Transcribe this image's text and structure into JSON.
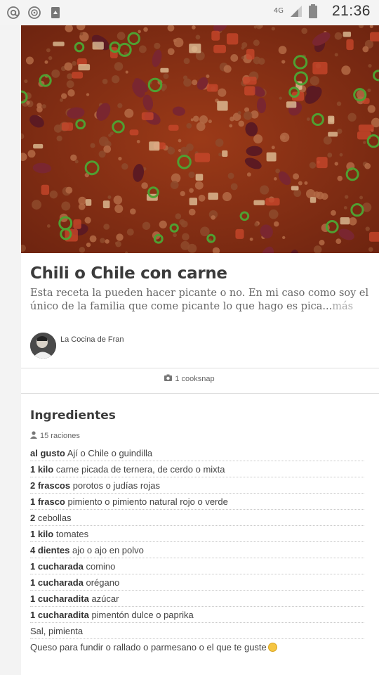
{
  "status_bar": {
    "network": "4G",
    "time": "21:36"
  },
  "recipe": {
    "title": "Chili o Chile con carne",
    "description": "Esta receta la pueden hacer picante o no. En mi caso como soy el único de la familia que come picante lo que hago es pica...",
    "more_link": "más",
    "author": "La Cocina de Fran",
    "cooksnaps": "1 cooksnap"
  },
  "ingredients": {
    "heading": "Ingredientes",
    "servings": "15 raciones",
    "items": [
      {
        "qty": "al gusto",
        "name": " Ají o Chile o guindilla"
      },
      {
        "qty": "1 kilo",
        "name": " carne picada de ternera, de cerdo o mixta"
      },
      {
        "qty": "2 frascos",
        "name": " porotos o judías rojas"
      },
      {
        "qty": "1 frasco",
        "name": " pimiento o pimiento natural rojo o verde"
      },
      {
        "qty": "2",
        "name": " cebollas"
      },
      {
        "qty": "1 kilo",
        "name": " tomates"
      },
      {
        "qty": "4 dientes",
        "name": " ajo o ajo en polvo"
      },
      {
        "qty": "1 cucharada",
        "name": " comino"
      },
      {
        "qty": "1 cucharada",
        "name": " orégano"
      },
      {
        "qty": "1 cucharadita",
        "name": " azúcar"
      },
      {
        "qty": "1 cucharadita",
        "name": " pimentón dulce o paprika"
      },
      {
        "qty": "",
        "name": "Sal, pimienta"
      },
      {
        "qty": "",
        "name": "Queso para fundir o rallado o parmesano o el que te guste"
      }
    ]
  }
}
